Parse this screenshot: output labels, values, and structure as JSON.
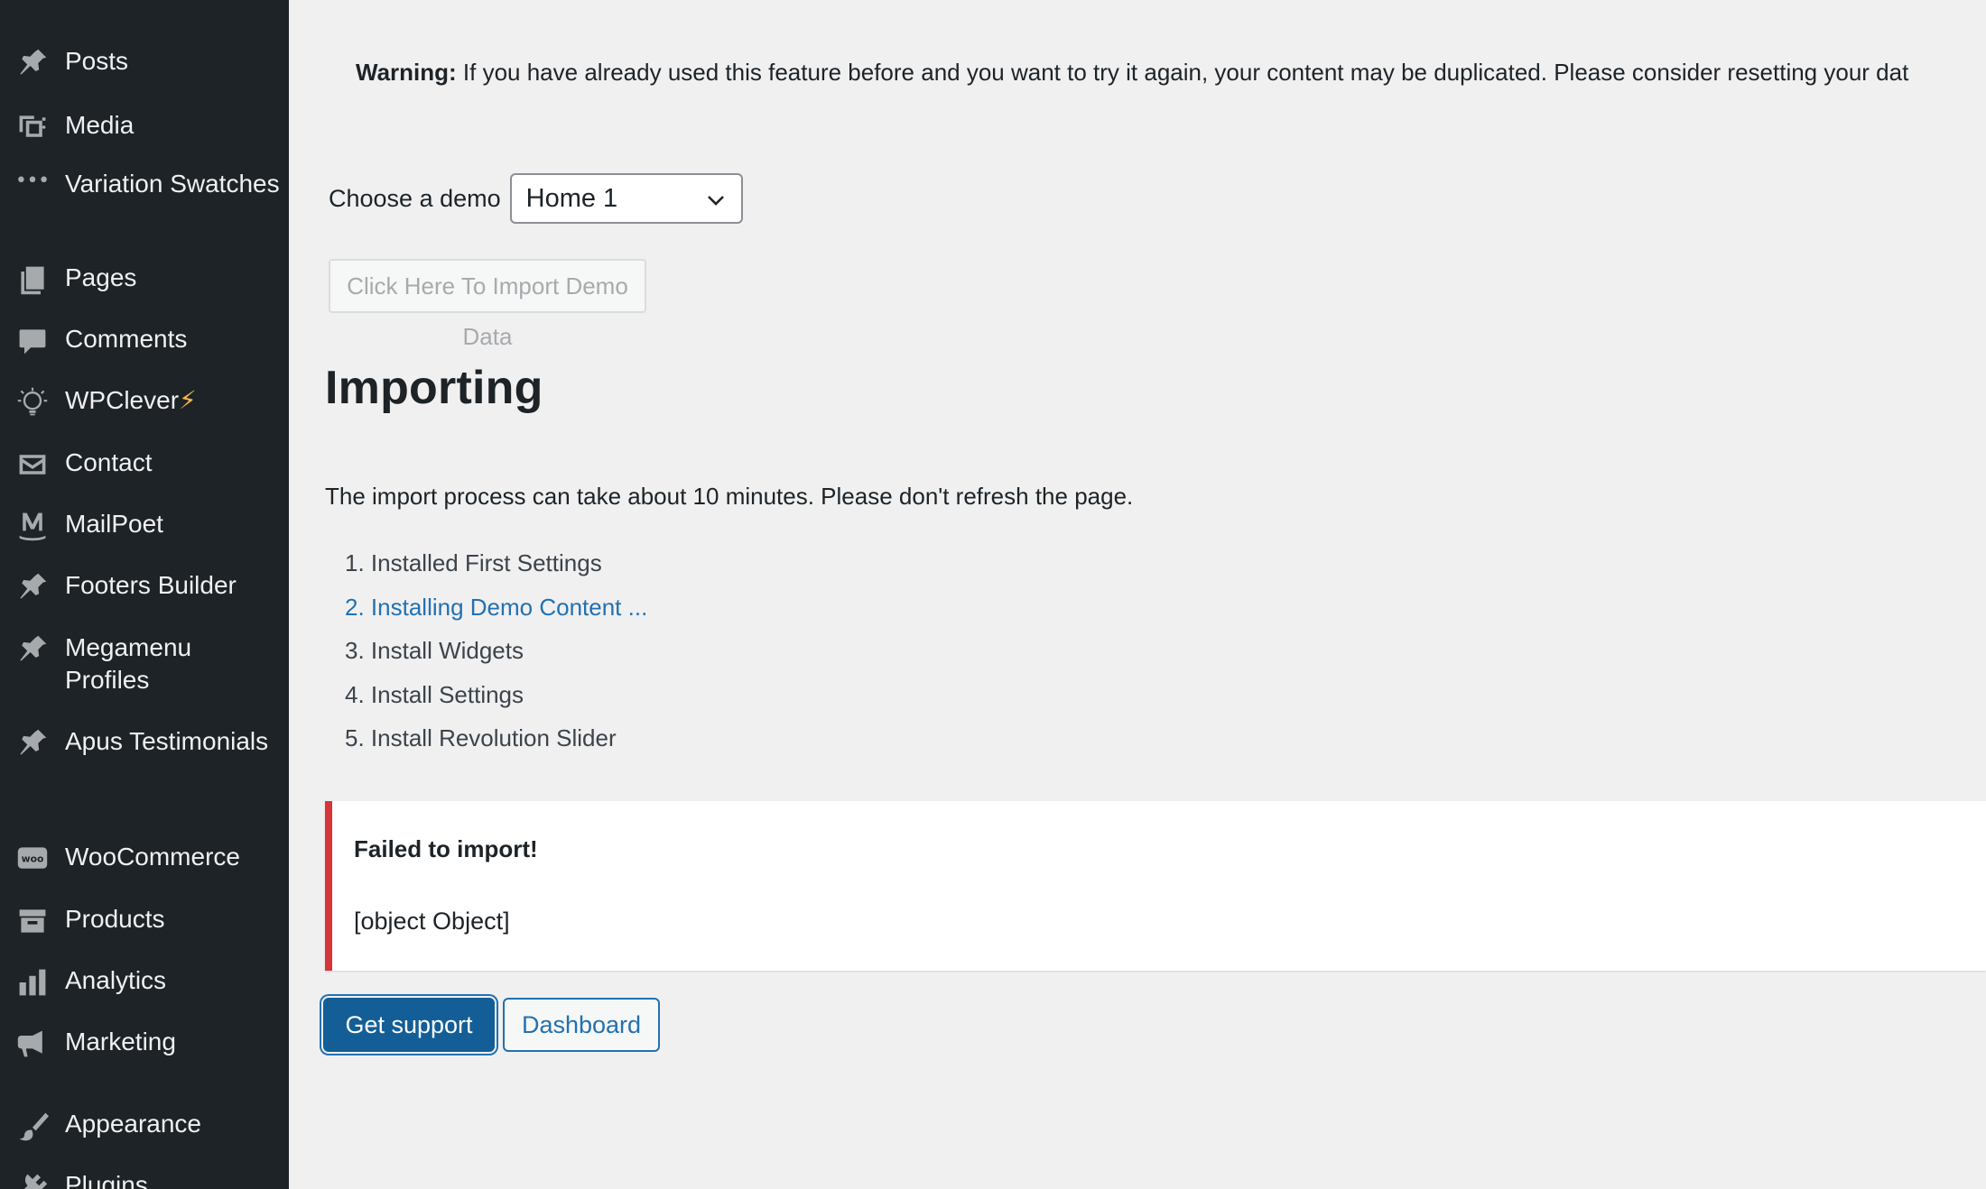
{
  "sidebar": {
    "items": [
      {
        "label": "Posts",
        "icon": "pin-icon"
      },
      {
        "label": "Media",
        "icon": "media-icon"
      },
      {
        "label": "Variation Swatches",
        "icon": "dots-icon"
      },
      {
        "label": "Pages",
        "icon": "pages-icon"
      },
      {
        "label": "Comments",
        "icon": "comment-icon"
      },
      {
        "label": "WPClever",
        "suffix": "⚡",
        "icon": "wpclever-icon"
      },
      {
        "label": "Contact",
        "icon": "mail-icon"
      },
      {
        "label": "MailPoet",
        "icon": "mailpoet-icon"
      },
      {
        "label": "Footers Builder",
        "icon": "pin-icon"
      },
      {
        "label": "Megamenu Profiles",
        "icon": "pin-icon"
      },
      {
        "label": "Apus Testimonials",
        "icon": "pin-icon"
      },
      {
        "label": "WooCommerce",
        "icon": "woo-icon"
      },
      {
        "label": "Products",
        "icon": "archive-icon"
      },
      {
        "label": "Analytics",
        "icon": "bar-chart-icon"
      },
      {
        "label": "Marketing",
        "icon": "megaphone-icon"
      },
      {
        "label": "Appearance",
        "icon": "brush-icon"
      },
      {
        "label": "Plugins",
        "icon": "plugin-icon"
      }
    ]
  },
  "warning": {
    "label": "Warning:",
    "text": " If you have already used this feature before and you want to try it again, your content may be duplicated. Please consider resetting your dat"
  },
  "demo": {
    "label": "Choose a demo",
    "selected": "Home 1"
  },
  "import_button": "Click Here To Import Demo Data",
  "importing": {
    "title": "Importing",
    "description": "The import process can take about 10 minutes. Please don't refresh the page.",
    "steps": [
      {
        "num": "1.",
        "text": "Installed First Settings"
      },
      {
        "num": "2.",
        "text": "Installing Demo Content ..."
      },
      {
        "num": "3.",
        "text": "Install Widgets"
      },
      {
        "num": "4.",
        "text": "Install Settings"
      },
      {
        "num": "5.",
        "text": "Install Revolution Slider"
      }
    ]
  },
  "notice": {
    "title": "Failed to import!",
    "body": "[object Object]"
  },
  "buttons": {
    "support": "Get support",
    "dashboard": "Dashboard"
  },
  "colors": {
    "sidebar_bg": "#1d2327",
    "accent": "#2271b1",
    "error": "#d63638"
  }
}
